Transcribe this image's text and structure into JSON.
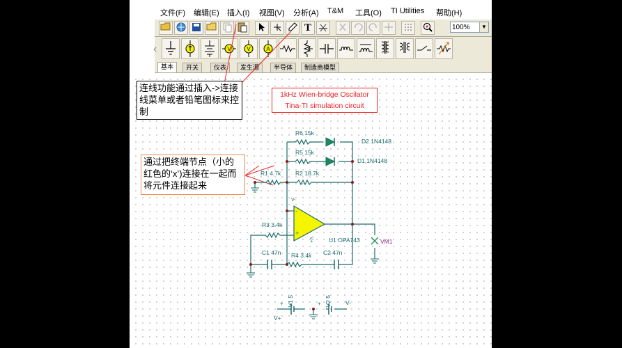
{
  "menu": [
    "文件(F)",
    "编辑(E)",
    "插入(I)",
    "视图(V)",
    "分析(A)",
    "T&M",
    "工具(O)",
    "TI Utilities",
    "帮助(H)"
  ],
  "toolbar": {
    "zoom_value": "100%",
    "text_tool_glyph": "T"
  },
  "tabs": [
    "基本",
    "开关",
    "仪表",
    "发生源",
    "半导体",
    "制造商模型"
  ],
  "annotations": {
    "wire_tip": "连线功能通过插入->连接线菜单或者铅笔图标来控制",
    "node_tip": "通过把终端节点（小的红色的‘x’)连接在一起而将元件连接起来"
  },
  "circuit_title": {
    "line1": "1kHz Wien-bridge Oscilator",
    "line2": "Tina-TI simulation circuit"
  },
  "components": {
    "r6": "R6 15k",
    "d2": "D2 1N4148",
    "r5": "R5 15k",
    "d1": "D1 1N4148",
    "r1": "R1 4.7k",
    "r2": "R2 18.7k",
    "r3": "R3 3.4k",
    "u1": "U1 OPA743",
    "vm1": "VM1",
    "c1": "C1 47n",
    "r4": "R4 3.4k",
    "c2": "C2 47n",
    "v1": "V1 5",
    "v2": "V2 5",
    "vplus": "V+",
    "vminus": "V-",
    "pin_minus": "-",
    "pin_plus": "+",
    "supply_plus_pin": "+",
    "supply_minus_pin": "V-",
    "v_label_top": "V-",
    "v_label_bottom": "V+"
  },
  "colors": {
    "wire": "#1a6b6b",
    "resistor": "#1a6b6b",
    "opamp_fill": "#f5f500",
    "node": "#8b1a1a",
    "title_border": "#e22222",
    "note2_border": "#f08a4b"
  }
}
